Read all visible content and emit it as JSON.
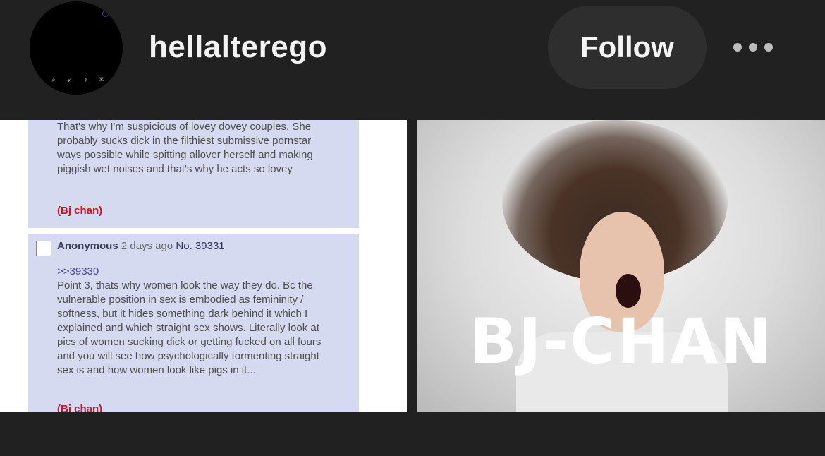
{
  "header": {
    "username": "hellalterego",
    "follow_label": "Follow",
    "more_icon": "ellipsis-icon"
  },
  "left_image": {
    "post1": {
      "body": "That's why I'm suspicious of lovey dovey couples. She probably sucks dick in the filthiest submissive pornstar ways possible while spitting allover herself and making piggish wet noises and that's why he acts so lovey",
      "tag": "(Bj chan)"
    },
    "post2": {
      "name": "Anonymous",
      "date": "2 days ago",
      "number": "No. 39331",
      "quote": ">>39330",
      "body": "Point 3, thats why women look the way they do. Bc the vulnerable position in sex is embodied as femininity / softness, but it hides something dark behind it which I explained and which straight sex shows. Literally look at pics of women sucking dick or getting fucked on all fours and you will see how psychologically tormenting straight sex is and how women look like pigs in it...",
      "tag": "(Bj chan)"
    }
  },
  "right_image": {
    "caption": "BJ-CHAN"
  }
}
